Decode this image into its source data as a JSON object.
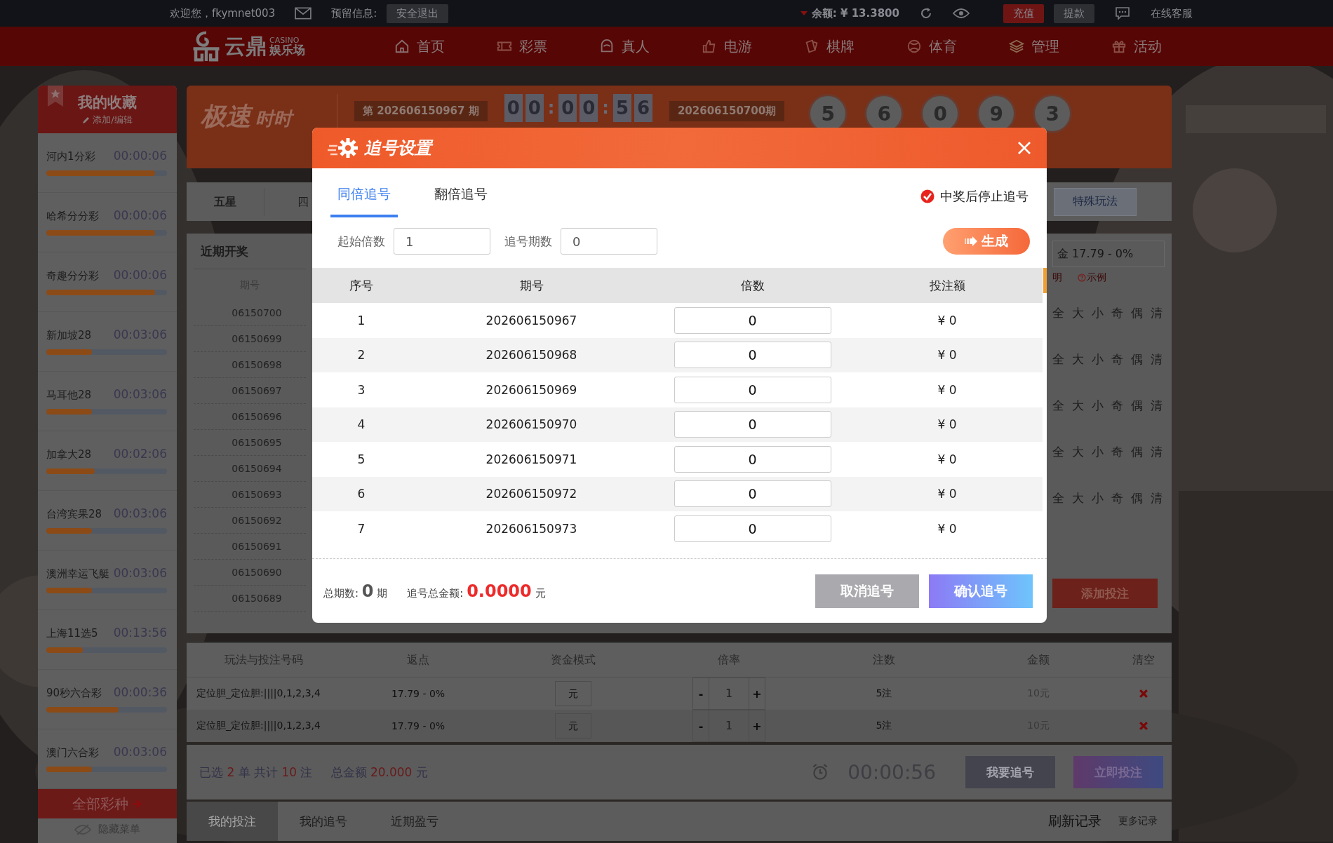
{
  "top_bar": {
    "welcome": "欢迎您，fkymnet003",
    "reserved_label": "预留信息:",
    "logout": "安全退出",
    "balance": "余额: ¥ 13.3800",
    "recharge": "充值",
    "withdraw": "提款",
    "support": "在线客服"
  },
  "logo": {
    "name": "云鼎",
    "casino": "CASINO",
    "subtitle": "娱乐场"
  },
  "nav": [
    {
      "label": "首页",
      "kind": "home"
    },
    {
      "label": "彩票",
      "kind": "ticket"
    },
    {
      "label": "真人",
      "kind": "live"
    },
    {
      "label": "电游",
      "kind": "thumb"
    },
    {
      "label": "棋牌",
      "kind": "cards"
    },
    {
      "label": "体育",
      "kind": "ball"
    },
    {
      "label": "管理",
      "kind": "layers"
    },
    {
      "label": "活动",
      "kind": "gift"
    }
  ],
  "sidebar": {
    "title": "我的收藏",
    "edit": "添加/编辑",
    "items": [
      {
        "name": "河内1分彩",
        "time": "00:00:06",
        "level": 0.9
      },
      {
        "name": "哈希分分彩",
        "time": "00:00:06",
        "level": 0.9
      },
      {
        "name": "奇趣分分彩",
        "time": "00:00:06",
        "level": 0.9
      },
      {
        "name": "新加坡28",
        "time": "00:03:06",
        "level": 0.38
      },
      {
        "name": "马耳他28",
        "time": "00:03:06",
        "level": 0.38
      },
      {
        "name": "加拿大28",
        "time": "00:02:06",
        "level": 0.4
      },
      {
        "name": "台湾宾果28",
        "time": "00:03:06",
        "level": 0.38
      },
      {
        "name": "澳洲幸运飞艇",
        "time": "00:03:06",
        "level": 0.38
      },
      {
        "name": "上海11选5",
        "time": "00:13:56",
        "level": 0.3
      },
      {
        "name": "90秒六合彩",
        "time": "00:00:36",
        "level": 0.6
      },
      {
        "name": "澳门六合彩",
        "time": "00:03:06",
        "level": 0.38
      }
    ],
    "all_button": "全部彩种",
    "hide_menu": "隐藏菜单"
  },
  "lottery": {
    "logo": "极速",
    "logo_sub": "时时",
    "current_issue": "第 202606150967 期",
    "countdown": [
      {
        "text": "0",
        "kind": "digit"
      },
      {
        "text": "0",
        "kind": "digit"
      },
      {
        "text": ":",
        "kind": "colon"
      },
      {
        "text": "0",
        "kind": "digit"
      },
      {
        "text": "0",
        "kind": "digit"
      },
      {
        "text": ":",
        "kind": "colon"
      },
      {
        "text": "5",
        "kind": "digit"
      },
      {
        "text": "6",
        "kind": "digit"
      }
    ],
    "last_issue": "202606150700期",
    "balls": [
      "5",
      "6",
      "0",
      "9",
      "3"
    ]
  },
  "play_tabs": [
    {
      "label": "五星",
      "selected": true
    },
    {
      "label": "四",
      "selected": false
    }
  ],
  "special_button": "特殊玩法",
  "recent_draws": {
    "title": "近期开奖",
    "column": "期号",
    "rows": [
      "06150700",
      "06150699",
      "06150698",
      "06150697",
      "06150696",
      "06150695",
      "06150694",
      "06150693",
      "06150692",
      "06150691",
      "06150690",
      "06150689"
    ]
  },
  "right_panel": {
    "rebate_field": "金 17.79 - 0%",
    "help": "明",
    "example": "示例",
    "quick_rows": [
      [
        "全",
        "大",
        "小",
        "奇",
        "偶",
        "清"
      ],
      [
        "全",
        "大",
        "小",
        "奇",
        "偶",
        "清"
      ],
      [
        "全",
        "大",
        "小",
        "奇",
        "偶",
        "清"
      ],
      [
        "全",
        "大",
        "小",
        "奇",
        "偶",
        "清"
      ],
      [
        "全",
        "大",
        "小",
        "奇",
        "偶",
        "清"
      ]
    ],
    "add_bet": "添加投注"
  },
  "bet_table": {
    "columns": [
      "玩法与投注号码",
      "返点",
      "资金模式",
      "倍率",
      "注数",
      "金额",
      "清空"
    ],
    "rows": [
      {
        "play": "定位胆_定位胆:||||0,1,2,3,4",
        "rebate": "17.79 - 0%",
        "mode": "元",
        "minus": "-",
        "multiplier": "1",
        "plus": "+",
        "count": "5注",
        "amount": "10元"
      },
      {
        "play": "定位胆_定位胆:||||0,1,2,3,4",
        "rebate": "17.79 - 0%",
        "mode": "元",
        "minus": "-",
        "multiplier": "1",
        "plus": "+",
        "count": "5注",
        "amount": "10元"
      }
    ]
  },
  "summary": {
    "parts": [
      {
        "text": "已选 ",
        "kind": "plain"
      },
      {
        "text": "2",
        "kind": "value"
      },
      {
        "text": " 单 共计 ",
        "kind": "plain"
      },
      {
        "text": "10",
        "kind": "value"
      },
      {
        "text": " 注",
        "kind": "plain"
      }
    ],
    "amount_parts": [
      {
        "text": "总金额 ",
        "kind": "plain"
      },
      {
        "text": "20.000",
        "kind": "value"
      },
      {
        "text": " 元",
        "kind": "plain"
      }
    ],
    "timer": "00:00:56",
    "chase_button": "我要追号",
    "bet_button": "立即投注"
  },
  "record_tabs": [
    {
      "label": "我的投注",
      "selected": true
    },
    {
      "label": "我的追号",
      "selected": false
    },
    {
      "label": "近期盈亏",
      "selected": false
    }
  ],
  "refresh": "刷新记录",
  "more": "更多记录",
  "dialog": {
    "title": "追号设置",
    "tabs": [
      {
        "label": "同倍追号",
        "selected": true
      },
      {
        "label": "翻倍追号",
        "selected": false
      }
    ],
    "stop_on_win": {
      "label": "中奖后停止追号",
      "checked": true
    },
    "start_multiple": {
      "label": "起始倍数",
      "value": "1"
    },
    "periods": {
      "label": "追号期数",
      "value": "0"
    },
    "generate": "生成",
    "columns": [
      "序号",
      "期号",
      "倍数",
      "投注额"
    ],
    "rows": [
      {
        "index": "1",
        "issue": "202606150967",
        "multiple": "0",
        "amount": "¥ 0"
      },
      {
        "index": "2",
        "issue": "202606150968",
        "multiple": "0",
        "amount": "¥ 0"
      },
      {
        "index": "3",
        "issue": "202606150969",
        "multiple": "0",
        "amount": "¥ 0"
      },
      {
        "index": "4",
        "issue": "202606150970",
        "multiple": "0",
        "amount": "¥ 0"
      },
      {
        "index": "5",
        "issue": "202606150971",
        "multiple": "0",
        "amount": "¥ 0"
      },
      {
        "index": "6",
        "issue": "202606150972",
        "multiple": "0",
        "amount": "¥ 0"
      },
      {
        "index": "7",
        "issue": "202606150973",
        "multiple": "0",
        "amount": "¥ 0"
      }
    ],
    "footer": {
      "periods_label": "总期数:",
      "periods": "0",
      "periods_unit": "期",
      "amount_label": "追号总金额:",
      "amount": "0.0000",
      "currency": "元"
    },
    "cancel": "取消追号",
    "confirm": "确认追号"
  }
}
